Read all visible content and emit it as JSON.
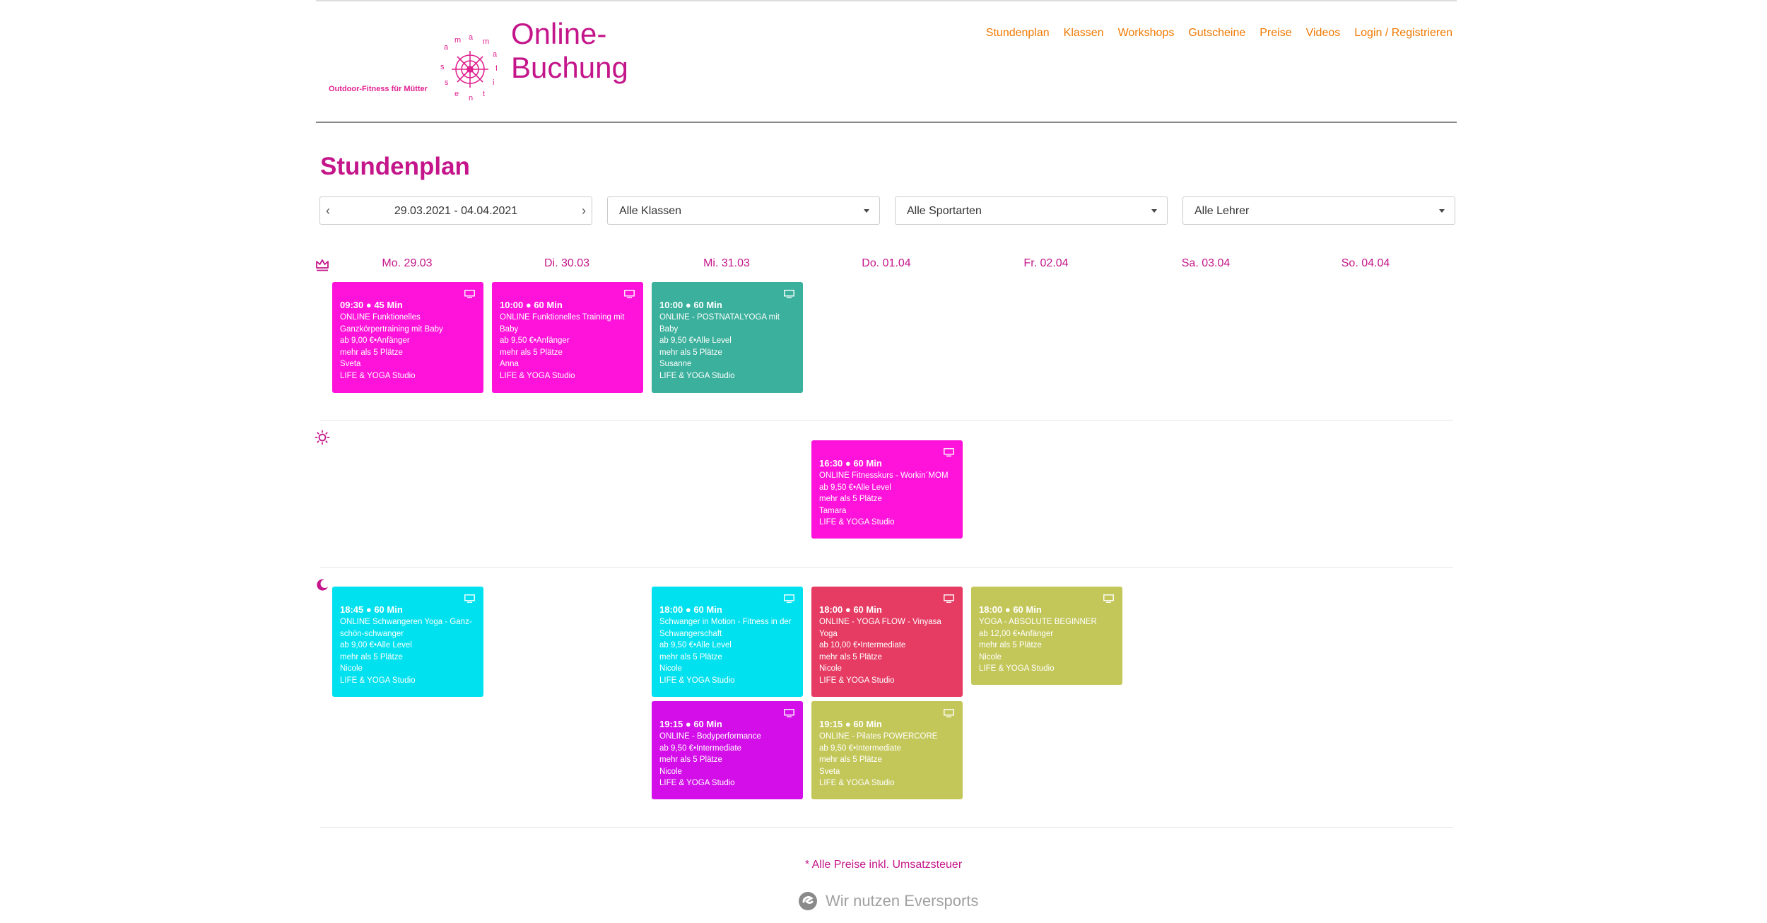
{
  "brand": {
    "logo_caption": "Outdoor-Fitness für Mütter",
    "logo_letters": "mama-fit",
    "title_line1": "Online-",
    "title_line2": "Buchung"
  },
  "nav": [
    "Stundenplan",
    "Klassen",
    "Workshops",
    "Gutscheine",
    "Preise",
    "Videos",
    "Login / Registrieren"
  ],
  "page_title": "Stundenplan",
  "filters": {
    "week": "29.03.2021 - 04.04.2021",
    "prev": "‹",
    "next": "›",
    "classes": "Alle Klassen",
    "sports": "Alle Sportarten",
    "teachers": "Alle Lehrer"
  },
  "days": [
    "Mo. 29.03",
    "Di. 30.03",
    "Mi. 31.03",
    "Do. 01.04",
    "Fr. 02.04",
    "Sa. 03.04",
    "So. 04.04"
  ],
  "icons": {
    "morning": "crown-icon",
    "midday": "sun-icon",
    "evening": "moon-icon",
    "online": "monitor-icon"
  },
  "colors": {
    "accent": "#c4168a",
    "nav": "#f07800",
    "magenta": "#ff12d9",
    "teal": "#3bb09c",
    "cyan": "#00e1f0",
    "red": "#e63b63",
    "olive": "#c3c75a",
    "purple": "#d30ee9"
  },
  "classes": [
    {
      "time": "09:30 ● 45 Min",
      "name": "ONLINE Funktionelles Ganzkörpertraining mit Baby",
      "price": "ab 9,00 €•Anfänger",
      "spots": "mehr als 5 Plätze",
      "teacher": "Sveta",
      "location": "LIFE & YOGA Studio"
    },
    {
      "time": "10:00 ● 60 Min",
      "name": "ONLINE Funktionelles Training mit Baby",
      "price": "ab 9,50 €•Anfänger",
      "spots": "mehr als 5 Plätze",
      "teacher": "Anna",
      "location": "LIFE & YOGA Studio"
    },
    {
      "time": "10:00 ● 60 Min",
      "name": "ONLINE - POSTNATALYOGA mit Baby",
      "price": "ab 9,50 €•Alle Level",
      "spots": "mehr als 5 Plätze",
      "teacher": "Susanne",
      "location": "LIFE & YOGA Studio"
    },
    {
      "time": "16:30 ● 60 Min",
      "name": "ONLINE Fitnesskurs - Workin´MOM",
      "price": "ab 9,50 €•Alle Level",
      "spots": "mehr als 5 Plätze",
      "teacher": "Tamara",
      "location": "LIFE & YOGA Studio"
    },
    {
      "time": "18:45 ● 60 Min",
      "name": "ONLINE Schwangeren Yoga - Ganz-schön-schwanger",
      "price": "ab 9,00 €•Alle Level",
      "spots": "mehr als 5 Plätze",
      "teacher": "Nicole",
      "location": "LIFE & YOGA Studio"
    },
    {
      "time": "18:00 ● 60 Min",
      "name": "Schwanger in Motion - Fitness in der Schwangerschaft",
      "price": "ab 9,50 €•Alle Level",
      "spots": "mehr als 5 Plätze",
      "teacher": "Nicole",
      "location": "LIFE & YOGA Studio"
    },
    {
      "time": "18:00 ● 60 Min",
      "name": "ONLINE - YOGA FLOW - Vinyasa Yoga",
      "price": "ab 10,00 €•Intermediate",
      "spots": "mehr als 5 Plätze",
      "teacher": "Nicole",
      "location": "LIFE & YOGA Studio"
    },
    {
      "time": "18:00 ● 60 Min",
      "name": "YOGA - ABSOLUTE BEGINNER",
      "price": "ab 12,00 €•Anfänger",
      "spots": "mehr als 5 Plätze",
      "teacher": "Nicole",
      "location": "LIFE & YOGA Studio"
    },
    {
      "time": "19:15 ● 60 Min",
      "name": "ONLINE - Bodyperformance",
      "price": "ab 9,50 €•Intermediate",
      "spots": "mehr als 5 Plätze",
      "teacher": "Nicole",
      "location": "LIFE & YOGA Studio"
    },
    {
      "time": "19:15 ● 60 Min",
      "name": "ONLINE - Pilates POWERCORE",
      "price": "ab 9,50 €•Intermediate",
      "spots": "mehr als 5 Plätze",
      "teacher": "Sveta",
      "location": "LIFE & YOGA Studio"
    }
  ],
  "footer": {
    "note": "* Alle Preise inkl. Umsatzsteuer",
    "powered": "Wir nutzen Eversports"
  }
}
